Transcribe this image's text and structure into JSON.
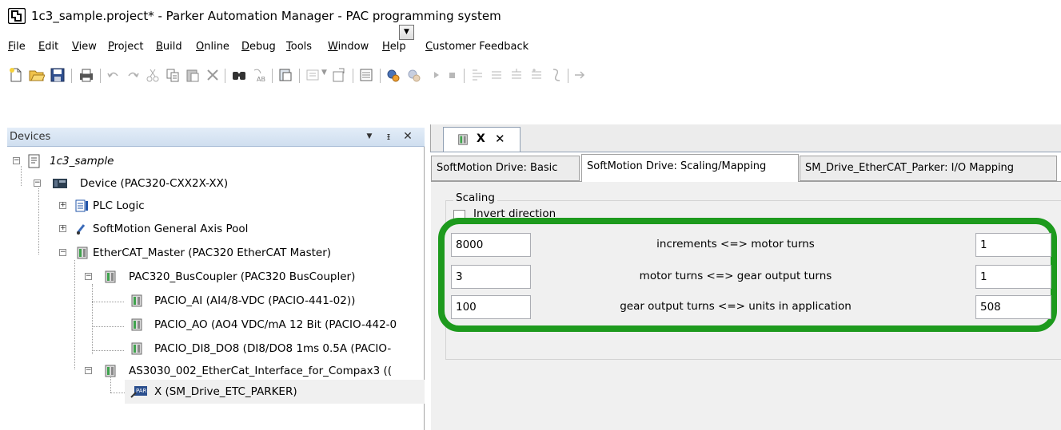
{
  "window": {
    "title": "1c3_sample.project* - Parker Automation Manager - PAC programming system"
  },
  "menu": [
    {
      "mnemonic": "F",
      "rest": "ile"
    },
    {
      "mnemonic": "E",
      "rest": "dit"
    },
    {
      "mnemonic": "V",
      "rest": "iew"
    },
    {
      "mnemonic": "P",
      "rest": "roject"
    },
    {
      "mnemonic": "B",
      "rest": "uild"
    },
    {
      "mnemonic": "O",
      "rest": "nline"
    },
    {
      "mnemonic": "D",
      "rest": "ebug"
    },
    {
      "mnemonic": "T",
      "rest": "ools"
    },
    {
      "mnemonic": "W",
      "rest": "indow"
    },
    {
      "mnemonic": "H",
      "rest": "elp"
    },
    {
      "mnemonic": "C",
      "rest": "ustomer Feedback"
    }
  ],
  "toolbar_icons": [
    "new-project-icon",
    "open-project-icon",
    "save-icon",
    "print-icon",
    "undo-icon",
    "redo-icon",
    "cut-icon",
    "copy-icon",
    "paste-icon",
    "delete-icon",
    "find-icon",
    "replace-icon",
    "clipboard-icon",
    "insert-icon",
    "export-icon",
    "monitor-icon",
    "login-icon",
    "logout-icon",
    "start-icon",
    "stop-icon",
    "step-into-icon",
    "step-over-icon",
    "step-out-icon",
    "breakpoint-icon",
    "force-icon",
    "write-icon"
  ],
  "devices_panel": {
    "title": "Devices",
    "tree": [
      {
        "label": "1c3_sample",
        "italic": true
      },
      {
        "label": "Device (PAC320-CXX2X-XX)"
      },
      {
        "label": "PLC Logic"
      },
      {
        "label": "SoftMotion General Axis Pool"
      },
      {
        "label": "EtherCAT_Master (PAC320 EtherCAT Master)"
      },
      {
        "label": "PAC320_BusCoupler (PAC320 BusCoupler)"
      },
      {
        "label": "PACIO_AI (AI4/8-VDC (PACIO-441-02))"
      },
      {
        "label": "PACIO_AO (AO4 VDC/mA 12 Bit (PACIO-442-0"
      },
      {
        "label": "PACIO_DI8_DO8 (DI8/DO8 1ms 0.5A (PACIO-"
      },
      {
        "label": "AS3030_002_EtherCat_Interface_for_Compax3 (("
      },
      {
        "label": "X (SM_Drive_ETC_PARKER)",
        "selected": true
      }
    ]
  },
  "editor": {
    "doc_tab_label": "X",
    "subtabs": [
      {
        "label": "SoftMotion Drive: Basic"
      },
      {
        "label": "SoftMotion Drive: Scaling/Mapping",
        "active": true
      },
      {
        "label": "SM_Drive_EtherCAT_Parker: I/O Mapping"
      }
    ],
    "scaling": {
      "group_label": "Scaling",
      "invert_label": "Invert direction",
      "invert_checked": false,
      "rows": [
        {
          "left": "8000",
          "caption": "increments <=> motor turns",
          "right": "1"
        },
        {
          "left": "3",
          "caption": "motor turns <=> gear output turns",
          "right": "1"
        },
        {
          "left": "100",
          "caption": "gear output turns <=> units in application",
          "right": "508"
        }
      ]
    }
  },
  "colors": {
    "highlight": "#1d9a1d",
    "panel_header": "#dde8f5",
    "selected_row": "#f0f0f0"
  }
}
